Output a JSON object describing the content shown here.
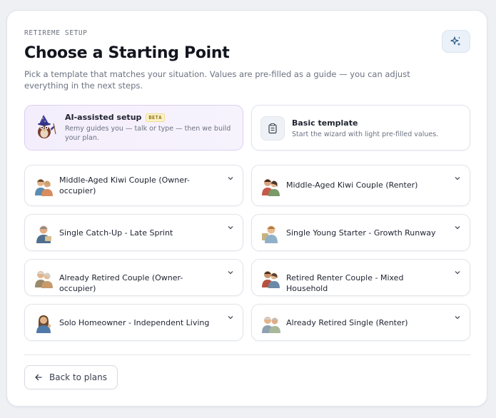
{
  "header": {
    "eyebrow": "RETIREME SETUP",
    "title": "Choose a Starting Point",
    "subtitle": "Pick a template that matches your situation. Values are pre-filled as a guide — you can adjust everything in the next steps.",
    "action_icon": "sparkle-icon"
  },
  "quick_start": {
    "ai": {
      "title": "AI-assisted setup",
      "badge": "BETA",
      "description": "Remy guides you — talk or type — then we build your plan.",
      "icon": "wizard-avatar"
    },
    "basic": {
      "title": "Basic template",
      "description": "Start the wizard with light pre-filled values.",
      "icon": "clipboard-icon"
    }
  },
  "templates": [
    {
      "label": "Middle-Aged Kiwi Couple (Owner-occupier)",
      "avatar": "couple-avatar",
      "expand_icon": "chevron-down-icon"
    },
    {
      "label": "Middle-Aged Kiwi Couple (Renter)",
      "avatar": "couple-avatar",
      "expand_icon": "chevron-down-icon"
    },
    {
      "label": "Single Catch-Up - Late Sprint",
      "avatar": "single-man-avatar",
      "expand_icon": "chevron-down-icon"
    },
    {
      "label": "Single Young Starter - Growth Runway",
      "avatar": "young-single-avatar",
      "expand_icon": "chevron-down-icon"
    },
    {
      "label": "Already Retired Couple (Owner-occupier)",
      "avatar": "retired-couple-avatar",
      "expand_icon": "chevron-down-icon"
    },
    {
      "label": "Retired Renter Couple - Mixed Household",
      "avatar": "couple-avatar",
      "expand_icon": "chevron-down-icon"
    },
    {
      "label": "Solo Homeowner - Independent Living",
      "avatar": "single-woman-avatar",
      "expand_icon": "chevron-down-icon"
    },
    {
      "label": "Already Retired Single (Renter)",
      "avatar": "retired-single-avatar",
      "expand_icon": "chevron-down-icon"
    }
  ],
  "footer": {
    "back_label": "Back to plans",
    "back_icon": "arrow-left-icon"
  },
  "colors": {
    "accent": "#2a5a8a",
    "ai_card_bg": "#f4eefc",
    "ai_card_border": "#dccff0",
    "beta_bg": "#fbf2c9"
  }
}
